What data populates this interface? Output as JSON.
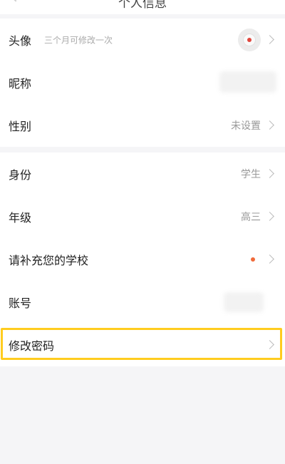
{
  "header": {
    "title": "个人信息",
    "back_icon": "chevron-left-icon"
  },
  "profile_group": {
    "avatar_row": {
      "label": "头像",
      "hint": "三个月可修改一次",
      "avatar_icon": "avatar-icon",
      "chevron_icon": "chevron-right-icon"
    },
    "nickname_row": {
      "label": "昵称",
      "value": ""
    },
    "gender_row": {
      "label": "性别",
      "value": "未设置",
      "chevron_icon": "chevron-right-icon"
    }
  },
  "account_group": {
    "identity_row": {
      "label": "身份",
      "value": "学生",
      "chevron_icon": "chevron-right-icon"
    },
    "grade_row": {
      "label": "年级",
      "value": "高三",
      "chevron_icon": "chevron-right-icon"
    },
    "school_row": {
      "label": "请补充您的学校",
      "indicator": "red-dot",
      "chevron_icon": "chevron-right-icon"
    },
    "account_row": {
      "label": "账号",
      "value": ""
    },
    "password_row": {
      "label": "修改密码",
      "chevron_icon": "chevron-right-icon"
    }
  },
  "colors": {
    "background": "#f5f5f7",
    "card": "#ffffff",
    "highlight_border": "#ffcc1f",
    "notification_dot": "#f06a3a",
    "secondary_text": "#999999"
  }
}
